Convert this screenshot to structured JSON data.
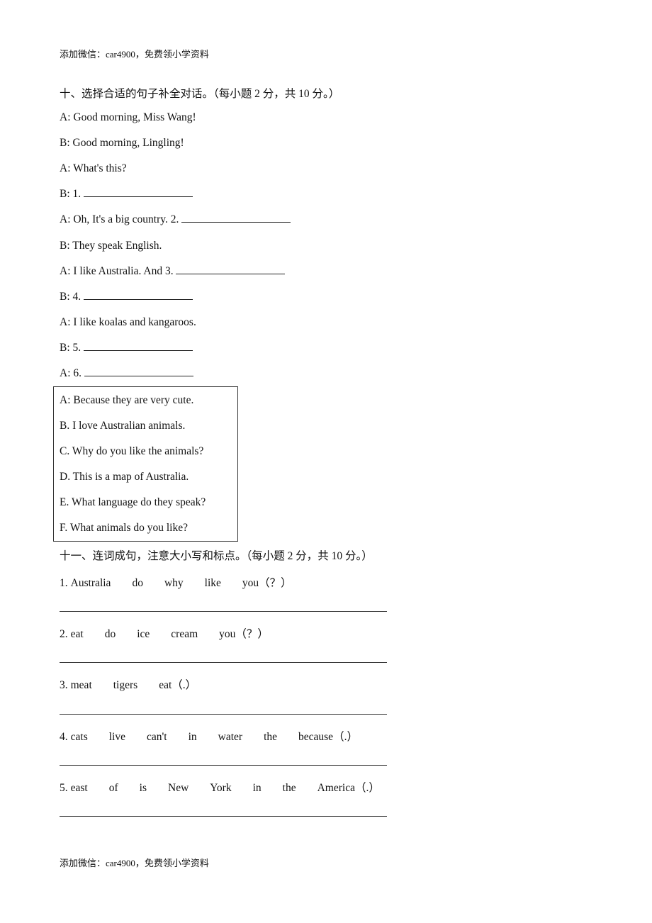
{
  "header_note": "添加微信：car4900，免费领小学资料",
  "footer_note": "添加微信：car4900，免费领小学资料",
  "section10": {
    "title": "十、选择合适的句子补全对话。（每小题 2 分，共 10 分。）",
    "dialogue": [
      {
        "prefix": "A: Good morning, Miss Wang!",
        "blank": false
      },
      {
        "prefix": "B: Good morning, Lingling!",
        "blank": false
      },
      {
        "prefix": "A: What's this?",
        "blank": false
      },
      {
        "prefix": "B: 1. ",
        "blank": true
      },
      {
        "prefix": "A: Oh, It's a big country. 2. ",
        "blank": true
      },
      {
        "prefix": "B: They speak English.",
        "blank": false
      },
      {
        "prefix": "A: I like Australia. And 3. ",
        "blank": true
      },
      {
        "prefix": "B: 4. ",
        "blank": true
      },
      {
        "prefix": "A: I like koalas and kangaroos.",
        "blank": false
      },
      {
        "prefix": "B: 5. ",
        "blank": true
      },
      {
        "prefix": "A: 6. ",
        "blank": true
      }
    ],
    "options": [
      "A: Because they are very cute.",
      "B. I love Australian animals.",
      "C. Why do you like the animals?",
      "D. This is a map of Australia.",
      "E. What language do they speak?",
      "F. What animals do you like?"
    ]
  },
  "section11": {
    "title": "十一、连词成句，注意大小写和标点。（每小题 2 分，共 10 分。）",
    "items": [
      {
        "num": "1.",
        "words": [
          "Australia",
          "do",
          "why",
          "like",
          "you（？）"
        ]
      },
      {
        "num": "2.",
        "words": [
          "eat",
          "do",
          "ice",
          "cream",
          "you（？）"
        ]
      },
      {
        "num": "3.",
        "words": [
          "meat",
          "tigers",
          "eat（.）"
        ]
      },
      {
        "num": "4.",
        "words": [
          "cats",
          "live",
          "can't",
          "in",
          "water",
          "the",
          "because（.）"
        ]
      },
      {
        "num": "5.",
        "words": [
          "east",
          "of",
          "is",
          "New",
          "York",
          "in",
          "the",
          "America（.）"
        ]
      }
    ]
  }
}
